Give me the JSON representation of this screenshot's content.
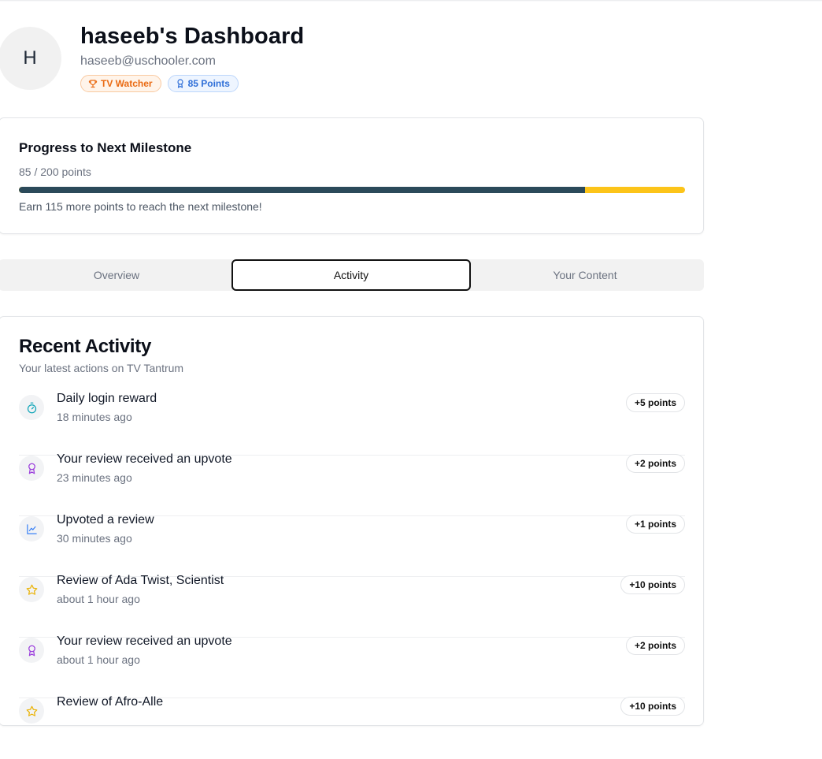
{
  "profile": {
    "initial": "H",
    "title": "haseeb's Dashboard",
    "email": "haseeb@uschooler.com",
    "badges": [
      {
        "label": "TV Watcher",
        "icon": "trophy-icon",
        "color": "#ea6a12"
      },
      {
        "label": "85 Points",
        "icon": "award-icon",
        "color": "#2f6fd8"
      }
    ]
  },
  "progress": {
    "title": "Progress to Next Milestone",
    "subtitle": "85 / 200 points",
    "fraction": 0.85,
    "note": "Earn 115 more points to reach the next milestone!",
    "fill_color": "#2b4a5a",
    "track_color": "#fcc419"
  },
  "tabs": [
    {
      "label": "Overview",
      "active": false
    },
    {
      "label": "Activity",
      "active": true
    },
    {
      "label": "Your Content",
      "active": false
    }
  ],
  "activity": {
    "title": "Recent Activity",
    "subtitle": "Your latest actions on TV Tantrum",
    "items": [
      {
        "title": "Daily login reward",
        "time": "18 minutes ago",
        "points": "+5 points",
        "icon": "timer-icon",
        "icon_color": "#12a6b8"
      },
      {
        "title": "Your review received an upvote",
        "time": "23 minutes ago",
        "points": "+2 points",
        "icon": "award-icon",
        "icon_color": "#9b3ddc"
      },
      {
        "title": "Upvoted a review",
        "time": "30 minutes ago",
        "points": "+1 points",
        "icon": "trend-chart-icon",
        "icon_color": "#3b82f6"
      },
      {
        "title": "Review of Ada Twist, Scientist",
        "time": "about 1 hour ago",
        "points": "+10 points",
        "icon": "star-icon",
        "icon_color": "#eab308"
      },
      {
        "title": "Your review received an upvote",
        "time": "about 1 hour ago",
        "points": "+2 points",
        "icon": "award-icon",
        "icon_color": "#9b3ddc"
      },
      {
        "title": "Review of Afro-Alle",
        "time": "",
        "points": "+10 points",
        "icon": "star-icon",
        "icon_color": "#eab308"
      }
    ]
  }
}
